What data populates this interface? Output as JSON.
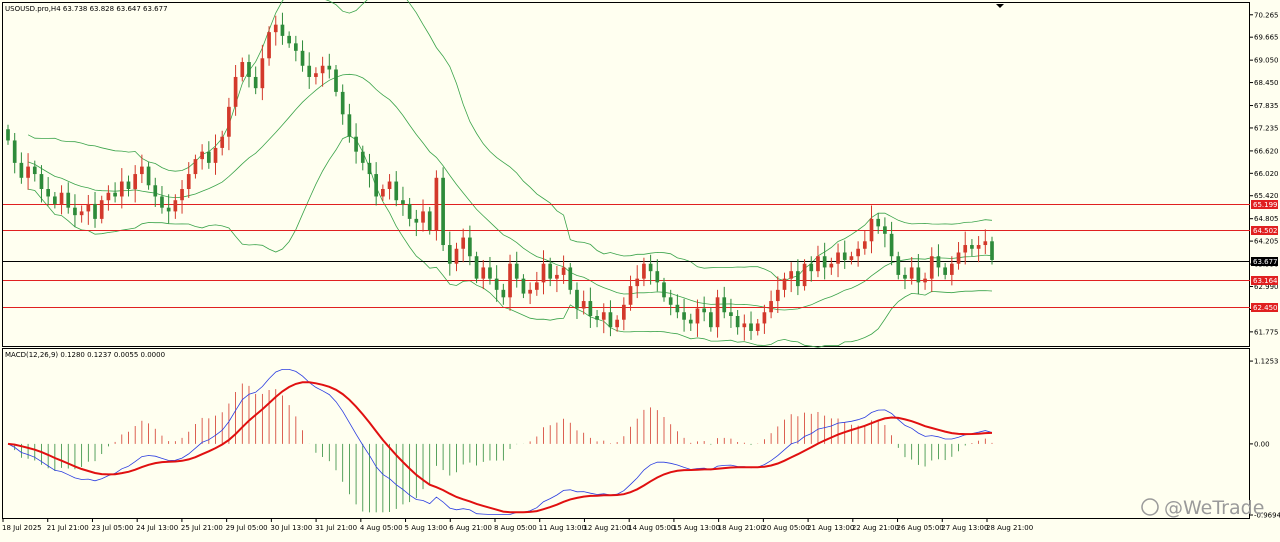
{
  "header": {
    "symbol_info": "USOUSD.pro,H4  63.738 63.828 63.647 63.677"
  },
  "macd_header": {
    "info": "MACD(12,26,9) 0.1280 0.1237 0.0055 0.0000"
  },
  "watermark": {
    "text": "@WeTrade"
  },
  "colors": {
    "background": "#fffff0",
    "bull_candle": "#d3392b",
    "bear_candle": "#2e8b3a",
    "band": "#3aa34a",
    "macd_main": "#2b3de0",
    "macd_signal": "#e01010",
    "level_red": "#e02020",
    "level_black": "#000000"
  },
  "chart_data": {
    "type": "candlestick",
    "y_axis_labels": [
      "70.265",
      "69.665",
      "69.050",
      "68.450",
      "67.835",
      "67.235",
      "66.620",
      "66.020",
      "65.420",
      "64.805",
      "64.205",
      "63.590",
      "62.990",
      "62.375",
      "61.775"
    ],
    "ylim": [
      61.45,
      70.5
    ],
    "levels": [
      {
        "value": 65.199,
        "label": "65.199",
        "color": "#e02020"
      },
      {
        "value": 64.502,
        "label": "64.502",
        "color": "#e02020"
      },
      {
        "value": 63.677,
        "label": "63.677",
        "color": "#000000"
      },
      {
        "value": 63.164,
        "label": "63.164",
        "color": "#e02020"
      },
      {
        "value": 62.45,
        "label": "62.450",
        "color": "#e02020"
      }
    ],
    "x_labels": [
      "18 Jul 2025",
      "21 Jul 21:00",
      "23 Jul 05:00",
      "24 Jul 13:00",
      "25 Jul 21:00",
      "29 Jul 05:00",
      "30 Jul 13:00",
      "31 Jul 21:00",
      "4 Aug 05:00",
      "5 Aug 13:00",
      "6 Aug 21:00",
      "8 Aug 05:00",
      "11 Aug 13:00",
      "12 Aug 21:00",
      "14 Aug 05:00",
      "15 Aug 13:00",
      "18 Aug 21:00",
      "20 Aug 05:00",
      "21 Aug 13:00",
      "22 Aug 21:00",
      "26 Aug 05:00",
      "27 Aug 13:00",
      "28 Aug 21:00"
    ],
    "close": [
      66.9,
      66.3,
      65.9,
      66.2,
      66.0,
      65.6,
      65.4,
      65.2,
      65.5,
      65.1,
      64.9,
      65.0,
      65.2,
      64.8,
      65.3,
      65.5,
      65.4,
      65.8,
      65.6,
      66.0,
      66.2,
      65.7,
      65.4,
      65.1,
      65.0,
      65.3,
      65.6,
      66.0,
      66.4,
      66.6,
      66.3,
      66.7,
      67.0,
      67.8,
      68.6,
      69.0,
      68.6,
      68.3,
      69.1,
      69.8,
      70.0,
      69.7,
      69.5,
      69.3,
      68.9,
      68.6,
      68.7,
      68.9,
      68.8,
      68.2,
      67.6,
      67.0,
      66.6,
      66.3,
      66.0,
      65.4,
      65.6,
      65.8,
      65.3,
      65.2,
      64.8,
      64.7,
      65.0,
      64.5,
      65.9,
      64.1,
      63.6,
      64.0,
      64.3,
      63.8,
      63.2,
      63.5,
      63.2,
      62.9,
      62.7,
      63.6,
      63.2,
      62.8,
      62.9,
      63.1,
      63.6,
      63.2,
      63.3,
      63.5,
      62.9,
      62.4,
      62.6,
      62.2,
      62.1,
      62.3,
      61.9,
      62.1,
      62.5,
      63.0,
      63.2,
      63.6,
      63.4,
      63.1,
      62.7,
      62.5,
      62.3,
      62.1,
      62.0,
      62.4,
      62.3,
      61.9,
      62.7,
      62.3,
      62.2,
      61.9,
      62.0,
      61.8,
      62.0,
      62.3,
      62.6,
      62.9,
      63.2,
      63.4,
      63.0,
      63.6,
      63.4,
      63.8,
      63.5,
      63.6,
      63.9,
      63.7,
      63.8,
      64.0,
      64.2,
      64.8,
      64.6,
      64.4,
      63.8,
      63.3,
      63.2,
      63.5,
      63.1,
      63.2,
      63.8,
      63.5,
      63.3,
      63.6,
      63.9,
      64.1,
      64.0,
      64.1,
      64.2,
      63.7
    ]
  },
  "macd_data": {
    "y_axis_labels": [
      "1.1253",
      "0.00",
      "-0.9694"
    ],
    "ylim": [
      -0.98,
      1.14
    ]
  }
}
